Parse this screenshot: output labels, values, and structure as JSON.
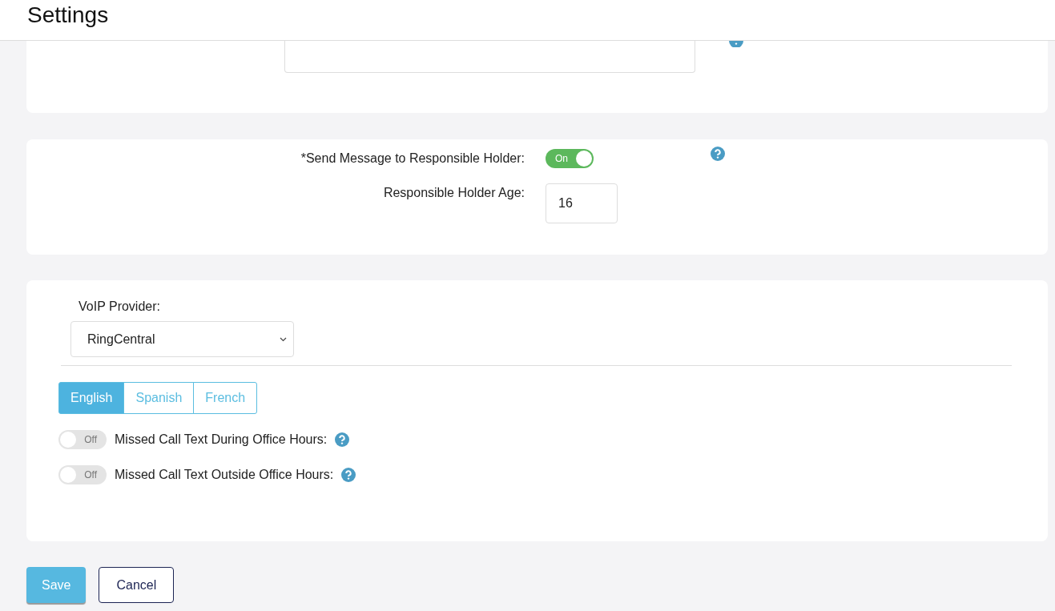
{
  "header": {
    "title": "Settings"
  },
  "responsible": {
    "send_message": {
      "label": "*Send Message to Responsible Holder:",
      "on": true,
      "state_label": "On"
    },
    "age": {
      "label": "Responsible Holder Age:",
      "value": "16"
    }
  },
  "voip": {
    "label": "VoIP Provider:",
    "value": "RingCentral"
  },
  "languages": [
    {
      "label": "English",
      "selected": true
    },
    {
      "label": "Spanish",
      "selected": false
    },
    {
      "label": "French",
      "selected": false
    }
  ],
  "missed_call": [
    {
      "label": "Missed Call Text During Office Hours:",
      "on": false,
      "state_label": "Off"
    },
    {
      "label": "Missed Call Text Outside Office Hours:",
      "on": false,
      "state_label": "Off"
    }
  ],
  "buttons": [
    {
      "label": "Save",
      "kind": "primary"
    },
    {
      "label": "Cancel",
      "kind": "secondary"
    }
  ]
}
